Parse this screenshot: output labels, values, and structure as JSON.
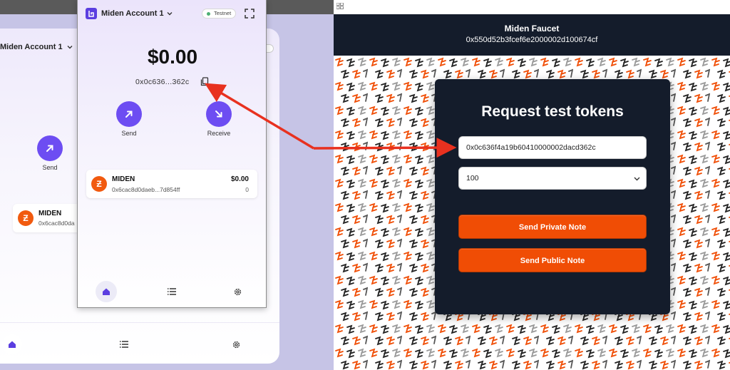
{
  "background_wallet": {
    "account_label": "Miden Account 1",
    "send_label": "Send",
    "asset": {
      "name": "MIDEN",
      "address": "0x6cac8d0da"
    }
  },
  "popup": {
    "account_label": "Miden Account 1",
    "network_badge": "Testnet",
    "balance": "$0.00",
    "address": "0x0c636...362c",
    "actions": {
      "send": "Send",
      "receive": "Receive"
    },
    "asset": {
      "name": "MIDEN",
      "address": "0x6cac8d0daeb...7d854ff",
      "value": "$0.00",
      "amount": "0"
    },
    "nav": [
      "home-icon",
      "list-icon",
      "settings-icon"
    ]
  },
  "faucet": {
    "title": "Miden Faucet",
    "address": "0x550d52b3fcef6e2000002d100674cf",
    "card_title": "Request test tokens",
    "recipient_value": "0x0c636f4a19b60410000002dacd362c",
    "amount_selected": "100",
    "buttons": {
      "private": "Send Private Note",
      "public": "Send Public Note"
    }
  },
  "colors": {
    "accent": "#6d4df2",
    "faucet_dark": "#141c2b",
    "faucet_orange": "#f04d05",
    "arrow_red": "#e8311f",
    "miden_logo": "#f15a0f"
  }
}
